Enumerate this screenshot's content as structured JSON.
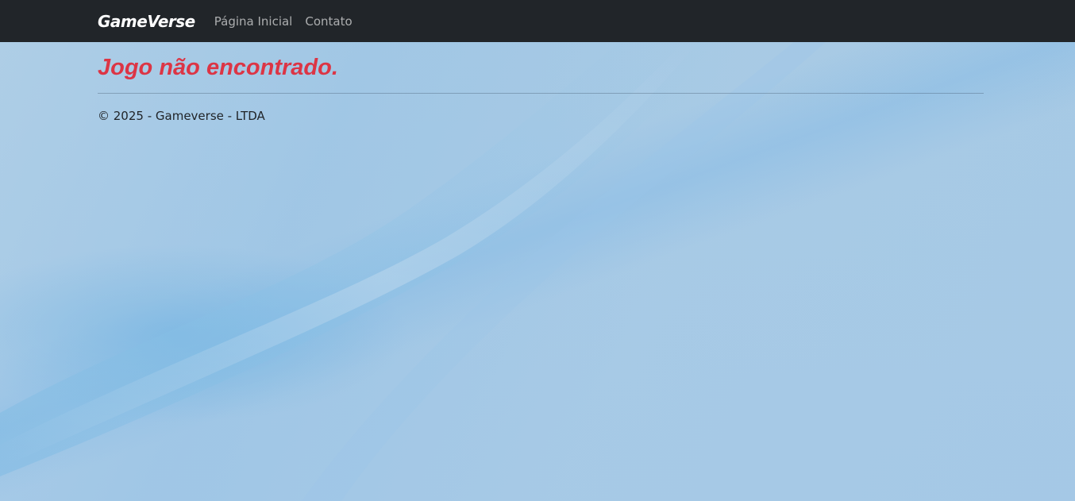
{
  "navbar": {
    "brand": "GameVerse",
    "links": [
      {
        "label": "Página Inicial"
      },
      {
        "label": "Contato"
      }
    ],
    "background": "#212529"
  },
  "main": {
    "message": "Jogo não encontrado.",
    "message_color": "#dc3545"
  },
  "footer": {
    "text": "© 2025 - Gameverse - LTDA"
  },
  "theme": {
    "page_background": "#a9cbe6"
  }
}
